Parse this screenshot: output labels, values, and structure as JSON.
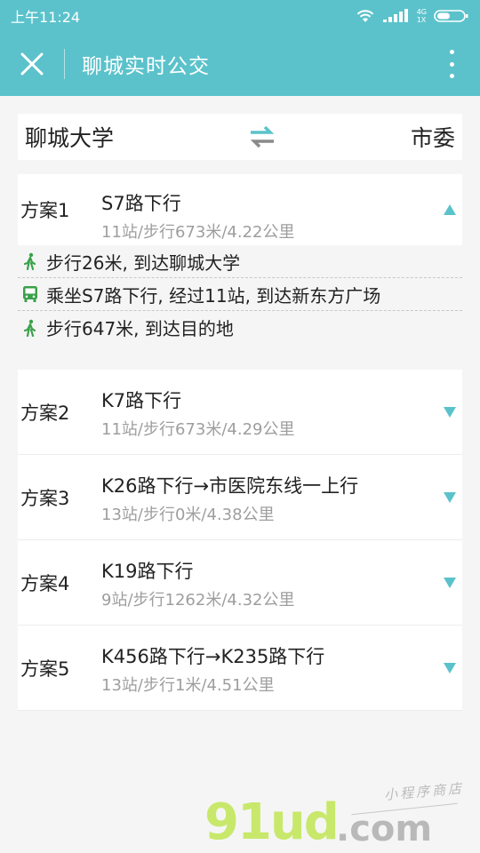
{
  "status_bar": {
    "time": "上午11:24",
    "network": "4G",
    "network_sub": "1X"
  },
  "nav": {
    "title": "聊城实时公交"
  },
  "route": {
    "from": "聊城大学",
    "to": "市委"
  },
  "expanded_plan": {
    "number": "方案1",
    "line": "S7路下行",
    "meta": "11站/步行673米/4.22公里",
    "steps": [
      {
        "icon": "walk-icon",
        "text": "步行26米, 到达聊城大学"
      },
      {
        "icon": "bus-icon",
        "text": "乘坐S7路下行, 经过11站, 到达新东方广场"
      },
      {
        "icon": "walk-icon",
        "text": "步行647米, 到达目的地"
      }
    ]
  },
  "plans": [
    {
      "number": "方案2",
      "line": "K7路下行",
      "meta": "11站/步行673米/4.29公里"
    },
    {
      "number": "方案3",
      "line": "K26路下行→市医院东线一上行",
      "meta": "13站/步行0米/4.38公里"
    },
    {
      "number": "方案4",
      "line": "K19路下行",
      "meta": "9站/步行1262米/4.32公里"
    },
    {
      "number": "方案5",
      "line": "K456路下行→K235路下行",
      "meta": "13站/步行1米/4.51公里"
    }
  ],
  "watermark": {
    "main": "91ud",
    "domain": ".com",
    "sub": "小程序商店"
  },
  "colors": {
    "header": "#5bc2cb",
    "accent": "#5bc2cb",
    "walk": "#3aa14a",
    "bus": "#3aa14a"
  }
}
